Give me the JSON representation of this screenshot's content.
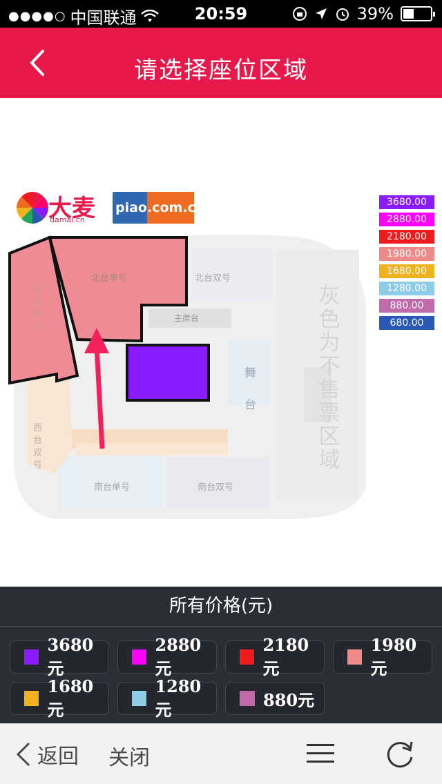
{
  "status_bar": {
    "carrier": "中国联通",
    "time": "20:59",
    "battery": "39%",
    "battery_level": 0.39
  },
  "nav": {
    "title": "请选择座位区域"
  },
  "map": {
    "logos": {
      "damai": "大麦",
      "damai_sub": "damai.cn",
      "piao": "piao.com.cn"
    },
    "labels": {
      "north_single": "北台单号",
      "north_double": "北台双号",
      "east_single": "东台单号",
      "west_double": "西台双号",
      "south_single": "南台单号",
      "south_double": "南台双号",
      "main_stage": "主席台",
      "stage": "舞台",
      "gray_note": "灰色为不售票区域"
    }
  },
  "legend": [
    {
      "label": "3680.00",
      "color": "#8a1bff"
    },
    {
      "label": "2880.00",
      "color": "#ff00ff"
    },
    {
      "label": "2180.00",
      "color": "#ee1c1c"
    },
    {
      "label": "1980.00",
      "color": "#f08a8a"
    },
    {
      "label": "1680.00",
      "color": "#f0b21e"
    },
    {
      "label": "1280.00",
      "color": "#8ecbe7"
    },
    {
      "label": "880.00",
      "color": "#c06aaa"
    },
    {
      "label": "680.00",
      "color": "#2a59b5"
    }
  ],
  "price_panel": {
    "title": "所有价格(元)",
    "prices": [
      {
        "label": "3680元",
        "color": "#8a1bff"
      },
      {
        "label": "2880元",
        "color": "#ff00ff"
      },
      {
        "label": "2180元",
        "color": "#ee1c1c"
      },
      {
        "label": "1980元",
        "color": "#f08a8a"
      },
      {
        "label": "1680元",
        "color": "#f0b21e"
      },
      {
        "label": "1280元",
        "color": "#8ecbe7"
      },
      {
        "label": "880元",
        "color": "#c06aaa"
      }
    ]
  },
  "bottom_bar": {
    "back": "返回",
    "close": "关闭"
  },
  "colors": {
    "accent": "#e8194a",
    "panel": "#2b2e36"
  }
}
